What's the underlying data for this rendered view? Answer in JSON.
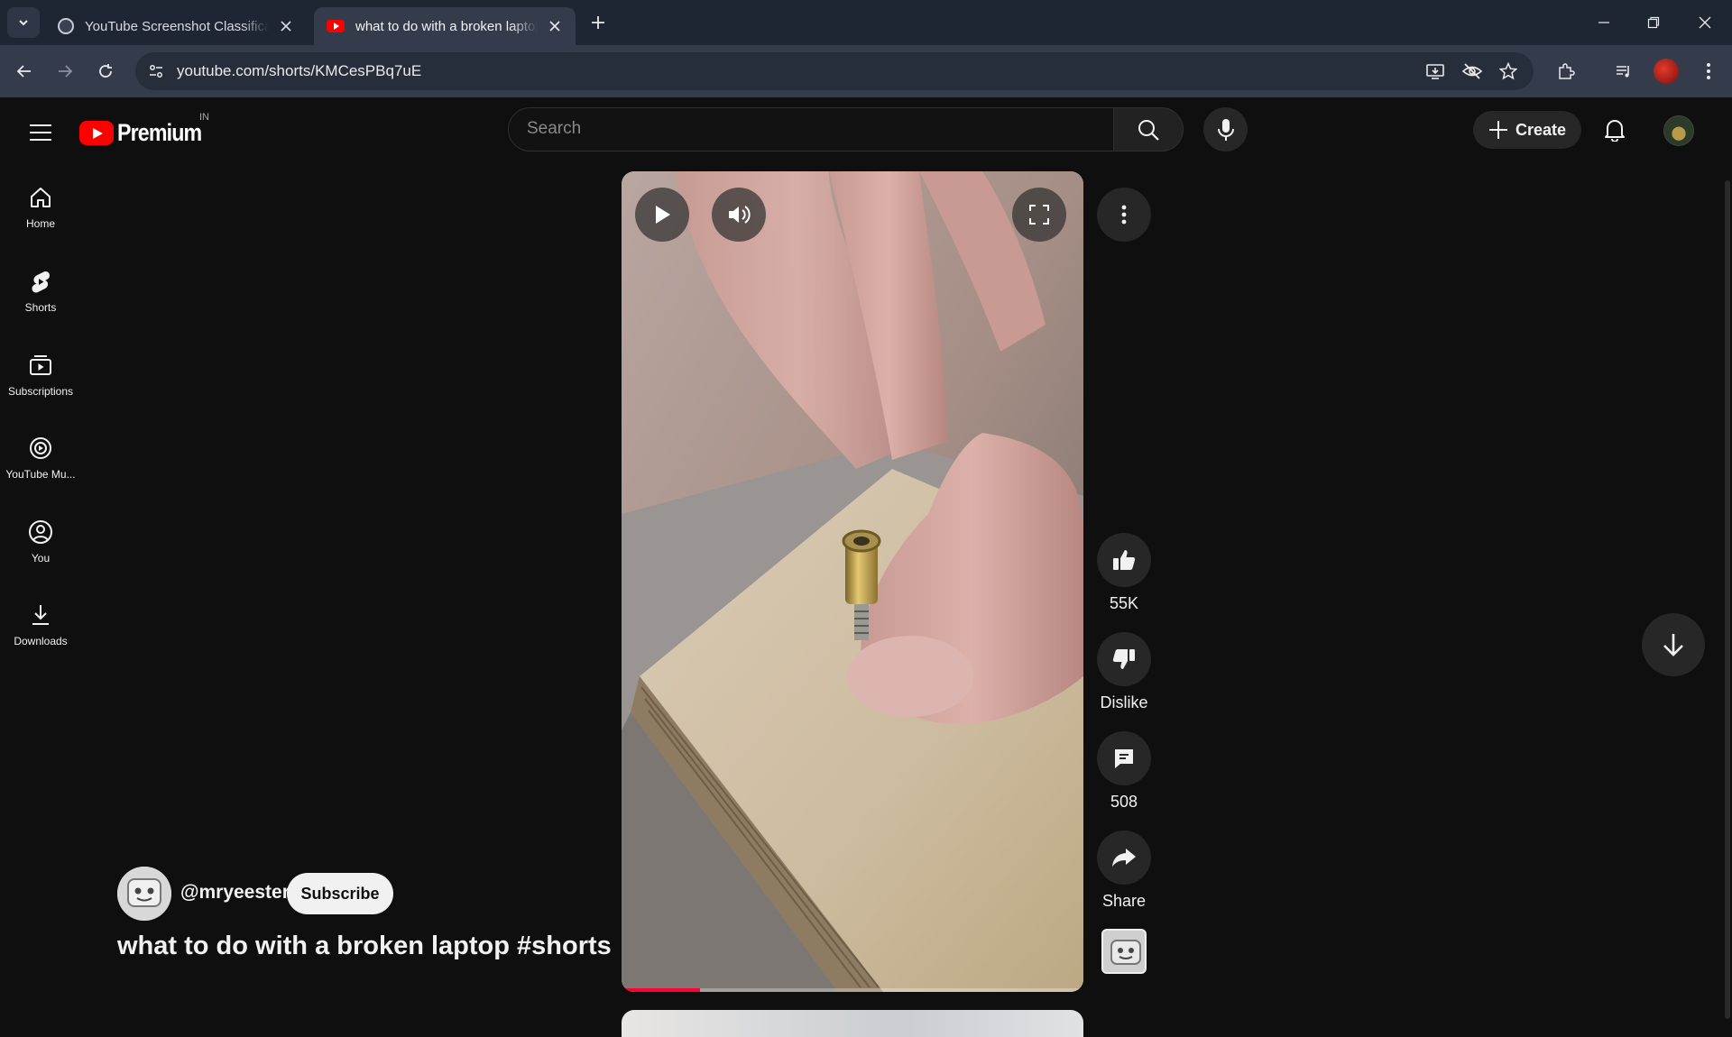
{
  "browser": {
    "tabs": [
      {
        "title": "YouTube Screenshot Classificati",
        "active": false
      },
      {
        "title": "what to do with a broken laptop",
        "active": true
      }
    ],
    "url": "youtube.com/shorts/KMCesPBq7uE"
  },
  "masthead": {
    "logo_text": "Premium",
    "country_code": "IN",
    "search_placeholder": "Search",
    "create_label": "Create"
  },
  "guide": {
    "items": [
      {
        "label": "Home",
        "icon": "home-icon"
      },
      {
        "label": "Shorts",
        "icon": "shorts-icon"
      },
      {
        "label": "Subscriptions",
        "icon": "subscriptions-icon"
      },
      {
        "label": "YouTube Mu...",
        "icon": "youtube-music-icon"
      },
      {
        "label": "You",
        "icon": "you-icon"
      },
      {
        "label": "Downloads",
        "icon": "downloads-icon"
      }
    ]
  },
  "short": {
    "channel": "@mryeester",
    "subscribe_label": "Subscribe",
    "title": "what to do with a broken laptop #shorts",
    "progress": 0.17,
    "actions": {
      "like_count": "55K",
      "dislike_label": "Dislike",
      "comments_count": "508",
      "share_label": "Share"
    }
  },
  "colors": {
    "background": "#0f0f0f",
    "brand_red": "#ff0000",
    "progress_red": "#ff0033",
    "chrome_tabstrip": "#1f2633",
    "chrome_toolbar": "#343c4c"
  }
}
